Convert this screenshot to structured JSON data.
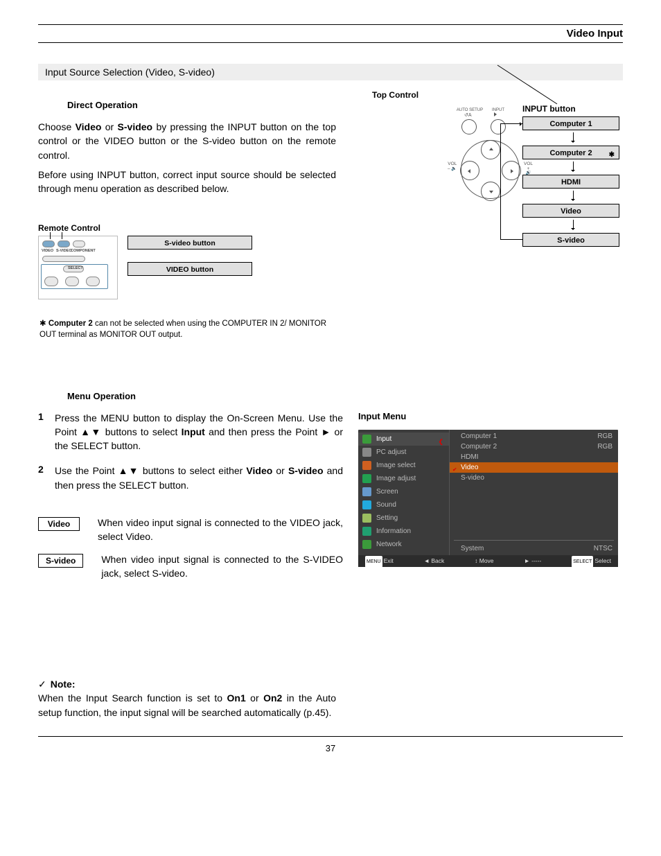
{
  "header_right": "Video Input",
  "title1": "Input Source Selection (Video, S-video)",
  "direct_label": "Direct Operation",
  "para1a": "Choose ",
  "para1b_bold": "Video",
  "para1c": " or ",
  "para1d_bold": "S-video",
  "para1e": " by pressing the INPUT button on the top control or the VIDEO button or the S-video button on the remote control.",
  "para2": "Before using INPUT button, correct input source should be selected through menu operation as described below.",
  "remote_heading": "Remote Control",
  "remote_btn1": "VIDEO",
  "remote_btn2": "S-VIDEO",
  "remote_btn3": "COMPONENT",
  "remote_select": "SELECT",
  "remote_box1": "S-video button",
  "remote_box2": "VIDEO button",
  "top_control_heading": "Top Control",
  "top_auto_setup": "AUTO SETUP",
  "top_input": "INPUT",
  "top_vol_minus": "VOL",
  "top_vol_minus2": "–",
  "top_vol_plus": "VOL",
  "top_vol_plus2": "+",
  "top_input_btn": "INPUT button",
  "flow_box1": "Computer 1",
  "flow_box2": "Computer 2",
  "flow_box3": "HDMI",
  "flow_box4": "Video",
  "flow_box5": "S-video",
  "flow_asterisk": "✱",
  "footnote_a": "✱",
  "footnote_b_bold": "Computer 2",
  "footnote_c": " can not be selected when using the COMPUTER IN 2/ MONITOR OUT terminal as MONITOR OUT output.",
  "menu_op_label": "Menu Operation",
  "step1_a": "Press the MENU button to display the On-Screen Menu. Use the Point ▲▼ buttons to select ",
  "step1_b_bold": "Input",
  "step1_c": " and then press the Point ► or the SELECT button.",
  "step2_a": "Use the Point ▲▼ buttons to select either ",
  "step2_b_bold": "Video",
  "step2_c": " or ",
  "step2_d_bold": "S-video",
  "step2_e": " and then press the SELECT button.",
  "box_video": "Video",
  "box_svideo": "S-video",
  "connect1": "When video input signal is connected to the VIDEO jack, select Video.",
  "connect2": "When video input signal is connected to the S-VIDEO jack, select S-video.",
  "osd_heading": "Input Menu",
  "osd_items": [
    "Input",
    "PC adjust",
    "Image select",
    "Image adjust",
    "Screen",
    "Sound",
    "Setting",
    "Information",
    "Network"
  ],
  "osd_right": [
    {
      "name": "Computer 1",
      "val": "RGB"
    },
    {
      "name": "Computer 2",
      "val": "RGB"
    },
    {
      "name": "HDMI",
      "val": ""
    },
    {
      "name": "Video",
      "val": ""
    },
    {
      "name": "S-video",
      "val": ""
    }
  ],
  "osd_system_label": "System",
  "osd_system_val": "NTSC",
  "osd_exit": "Exit",
  "osd_back": "Back",
  "osd_move": "Move",
  "osd_dash": "-----",
  "osd_select": "Select",
  "osd_menu_kbd": "MENU",
  "osd_select_kbd": "SELECT",
  "note_title": "Note:",
  "note_a": "When the Input Search function is set to ",
  "note_b_bold": "On1",
  "note_c": " or ",
  "note_d_bold": "On2",
  "note_e": " in the Auto setup function, the input signal will be searched automatically (p.45).",
  "page_num": "37",
  "osd_icon_colors": [
    "#3b9b3b",
    "#888",
    "#d06020",
    "#22a050",
    "#6699cc",
    "#22aadd",
    "#9bbf60",
    "#20a070",
    "#3b9b3b"
  ]
}
